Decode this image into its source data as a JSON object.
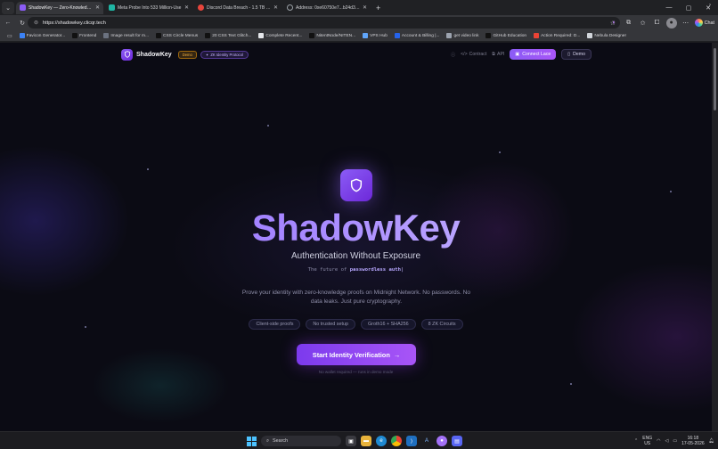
{
  "browser": {
    "tabs": [
      {
        "title": "ShadowKey — Zero-Knowledge Id",
        "favicon_color": "#8b5cf6",
        "active": true
      },
      {
        "title": "Meta Probe Into 533 Million-Use",
        "favicon_color": "#1fb5a3",
        "active": false
      },
      {
        "title": "Discord Data Breach - 1.5 TB of D",
        "favicon_color": "#e8453c",
        "active": false
      },
      {
        "title": "Address: 0xe60750e7...b24d36aaa",
        "favicon_color": "#9aa0a6",
        "active": false
      }
    ],
    "address": {
      "url": "https://shadowkey.clicqr.tech"
    },
    "copilot_label": "Chat",
    "bookmarks": [
      {
        "label": "Favicon Generator...",
        "color": "#3b82f6"
      },
      {
        "label": "Frontend",
        "color": "#111111"
      },
      {
        "label": "Image result for m...",
        "color": "#6b7280"
      },
      {
        "label": "CSS Circle Menus",
        "color": "#111111"
      },
      {
        "label": "20 CSS Text Glitch...",
        "color": "#111111"
      },
      {
        "label": "Complete Recent...",
        "color": "#e5e7eb"
      },
      {
        "label": "NitentNode/NITEN...",
        "color": "#111111"
      },
      {
        "label": "VPS Hub",
        "color": "#60a5fa"
      },
      {
        "label": "Account & Billing |...",
        "color": "#2563eb"
      },
      {
        "label": "get video link",
        "color": "#9ca3af"
      },
      {
        "label": "GitHub Education",
        "color": "#111111"
      },
      {
        "label": "Action Required: D...",
        "color": "#ea4335"
      },
      {
        "label": "Nebula Designer",
        "color": "#d1d5db"
      }
    ]
  },
  "site": {
    "nav": {
      "brand": "ShadowKey",
      "badge_demo": "Demo",
      "badge_zk": "ZK Identity Protocol",
      "links": [
        "Contract",
        "API"
      ],
      "connect_label": "Connect Lace",
      "demo_label": "Demo"
    },
    "hero": {
      "title": "ShadowKey",
      "subtitle": "Authentication Without Exposure",
      "typing_prefix": "The future of",
      "typing_highlight": "passwordless auth",
      "typing_cursor": "|",
      "description": "Prove your identity with zero-knowledge proofs on Midnight Network. No passwords. No data leaks. Just pure cryptography.",
      "chips": [
        "Client-side proofs",
        "No trusted setup",
        "Groth16 + SHA256",
        "8 ZK Circuits"
      ],
      "cta_label": "Start Identity Verification",
      "cta_arrow": "→",
      "cta_note": "No wallet required — runs in demo mode"
    },
    "accent": "#8b5cf6"
  },
  "taskbar": {
    "search_label": "Search",
    "lang_line1": "ENG",
    "lang_line2": "US",
    "time": "16:18",
    "date": "17-05-2026"
  }
}
